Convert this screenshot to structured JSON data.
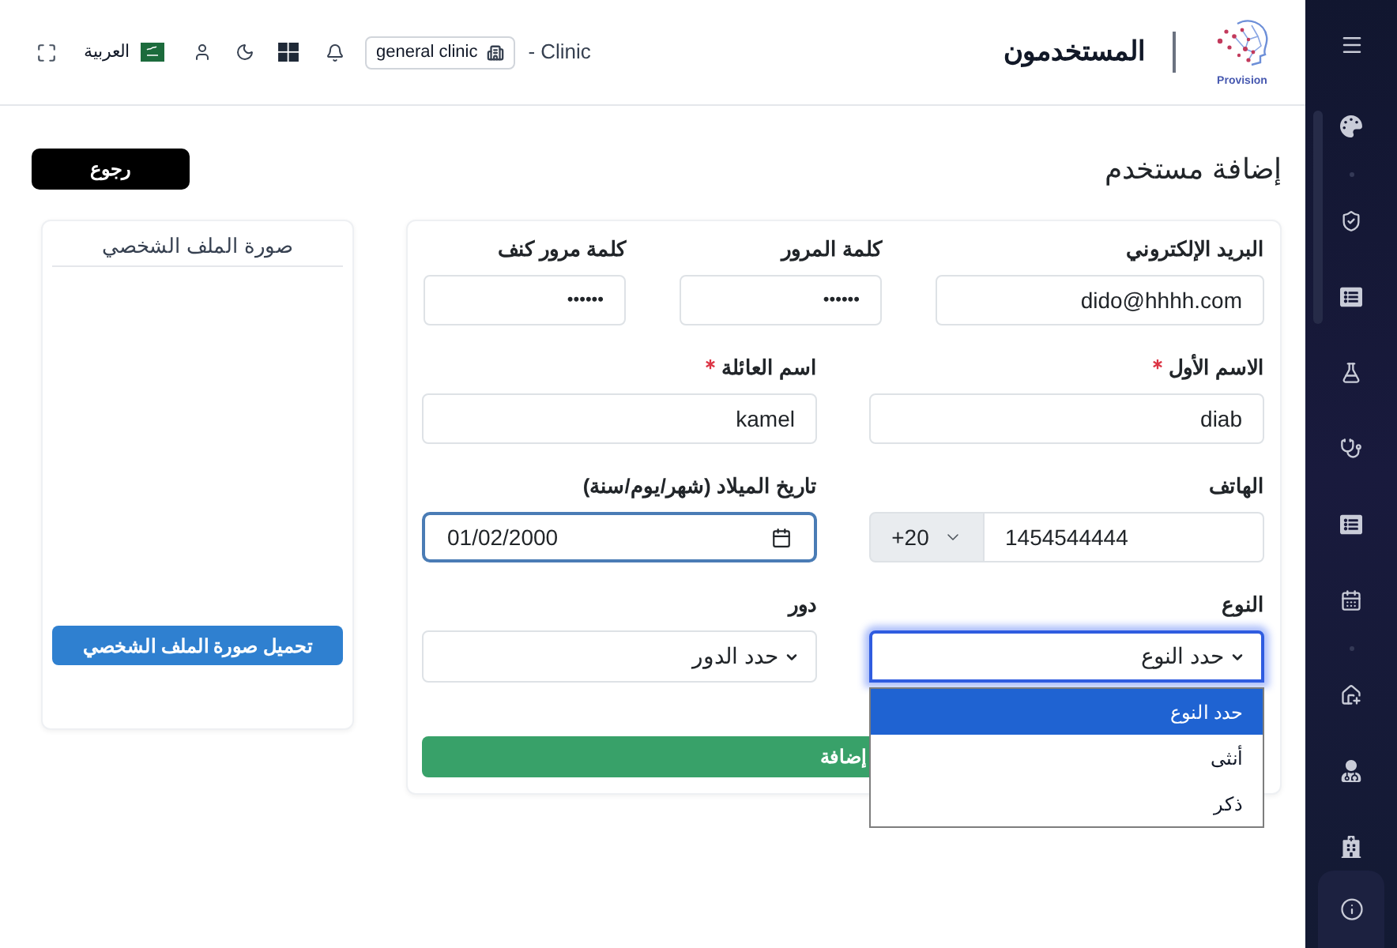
{
  "header": {
    "title": "المستخدمون",
    "logo_text": "Provision",
    "clinic_label": "- Clinic",
    "clinic_badge": "general clinic",
    "language": "العربية"
  },
  "page": {
    "title": "إضافة مستخدم",
    "back_button": "رجوع"
  },
  "form": {
    "rows": [
      {
        "fields": [
          {
            "kind": "text",
            "label": "البريد الإلكتروني",
            "required": false,
            "value": "dido@hhhh.com",
            "focused": false
          },
          {
            "kind": "password",
            "label": "كلمة المرور",
            "required": false,
            "value": "••••••",
            "focused": false
          },
          {
            "kind": "password",
            "label": "كلمة مرور كنف",
            "required": false,
            "value": "••••••",
            "focused": false
          }
        ]
      },
      {
        "fields": [
          {
            "kind": "text",
            "label": "الاسم الأول",
            "required": true,
            "value": "diab",
            "focused": false
          },
          {
            "kind": "text",
            "label": "اسم العائلة",
            "required": true,
            "value": "kamel",
            "focused": false
          }
        ]
      },
      {
        "fields": [
          {
            "kind": "phone",
            "label": "الهاتف",
            "required": false,
            "country_code": "+20",
            "value": "1454544444",
            "focused": false
          },
          {
            "kind": "date",
            "label": "تاريخ الميلاد (شهر/يوم/سنة)",
            "required": false,
            "value": "01/02/2000",
            "focused": true
          }
        ]
      },
      {
        "fields": [
          {
            "kind": "select",
            "label": "النوع",
            "required": false,
            "value": "حدد النوع",
            "focused": true,
            "expanded": true,
            "options": [
              {
                "label": "حدد النوع",
                "selected": true
              },
              {
                "label": "أنثى",
                "selected": false
              },
              {
                "label": "ذكر",
                "selected": false
              }
            ]
          },
          {
            "kind": "select",
            "label": "دور",
            "required": false,
            "value": "حدد الدور",
            "focused": false,
            "expanded": false
          }
        ]
      }
    ],
    "submit_button": "إضافة"
  },
  "profile_card": {
    "title": "صورة الملف الشخصي",
    "upload_button": "تحميل صورة الملف الشخصي"
  }
}
